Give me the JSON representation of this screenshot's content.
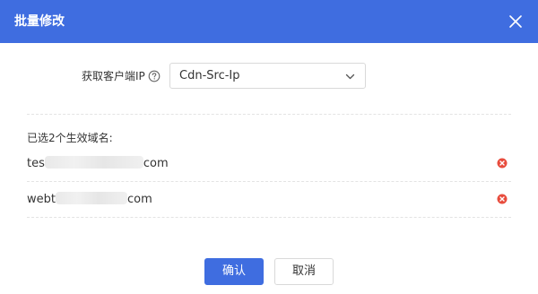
{
  "dialog": {
    "title": "批量修改",
    "close_icon": "close-icon",
    "header_color": "#3f6de0"
  },
  "form": {
    "label": "获取客户端IP",
    "help_icon": "question-circle-icon",
    "select": {
      "value": "Cdn-Src-Ip",
      "arrow_icon": "chevron-down-icon"
    }
  },
  "selected": {
    "title": "已选2个生效域名:",
    "domains": [
      {
        "prefix": "tes",
        "suffix": "com",
        "remove_icon": "remove-circle-icon"
      },
      {
        "prefix": "webt",
        "suffix": "com",
        "remove_icon": "remove-circle-icon"
      }
    ]
  },
  "buttons": {
    "confirm": "确认",
    "cancel": "取消"
  },
  "colors": {
    "primary": "#3f6de0",
    "danger": "#e84c3d"
  }
}
